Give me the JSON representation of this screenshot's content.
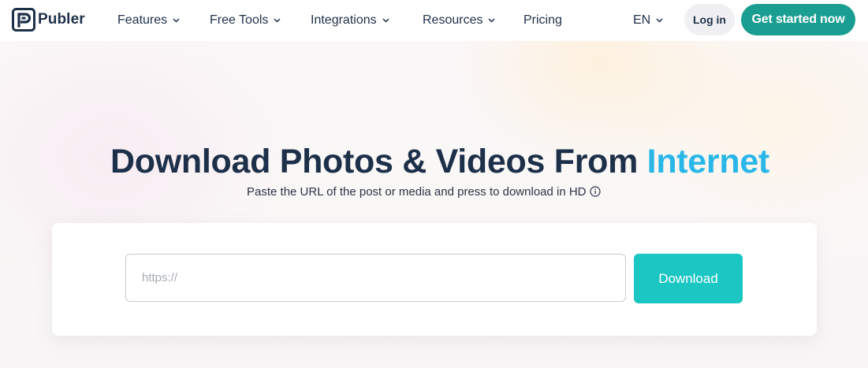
{
  "brand": {
    "name": "Publer",
    "logo_icon": "publer-logo-icon"
  },
  "nav": {
    "items": [
      {
        "label": "Features",
        "has_dropdown": true
      },
      {
        "label": "Free Tools",
        "has_dropdown": true
      },
      {
        "label": "Integrations",
        "has_dropdown": true
      },
      {
        "label": "Resources",
        "has_dropdown": true
      },
      {
        "label": "Pricing",
        "has_dropdown": false
      }
    ],
    "language": "EN",
    "login_label": "Log in",
    "cta_label": "Get started now"
  },
  "hero": {
    "title_main": "Download Photos & Videos From ",
    "title_accent": "Internet",
    "subtitle": "Paste the URL of the post or media and press to download in HD"
  },
  "downloader": {
    "input_placeholder": "https://",
    "input_value": "",
    "button_label": "Download"
  },
  "colors": {
    "primary_text": "#1d3049",
    "accent_blue": "#29b7e8",
    "cta_green": "#1a9e91",
    "download_teal": "#1ac7c2",
    "login_bg": "#f0f0f2"
  }
}
